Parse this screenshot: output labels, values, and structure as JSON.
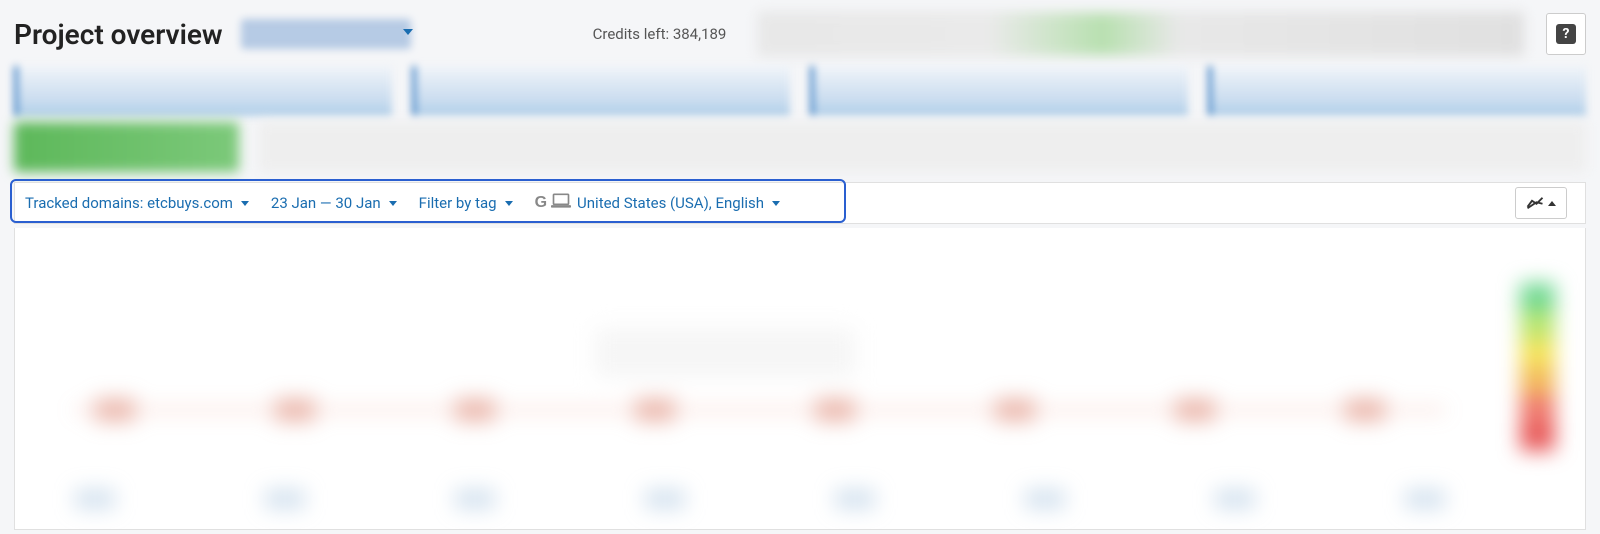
{
  "header": {
    "title": "Project overview",
    "credits_label": "Credits left: 384,189",
    "help_icon_label": "?"
  },
  "filters": {
    "tracked_domains_label": "Tracked domains: etcbuys.com",
    "date_range_label": "23 Jan — 30 Jan",
    "filter_by_tag_label": "Filter by tag",
    "locale_label": "United States (USA), English",
    "google_icon_letter": "G"
  }
}
